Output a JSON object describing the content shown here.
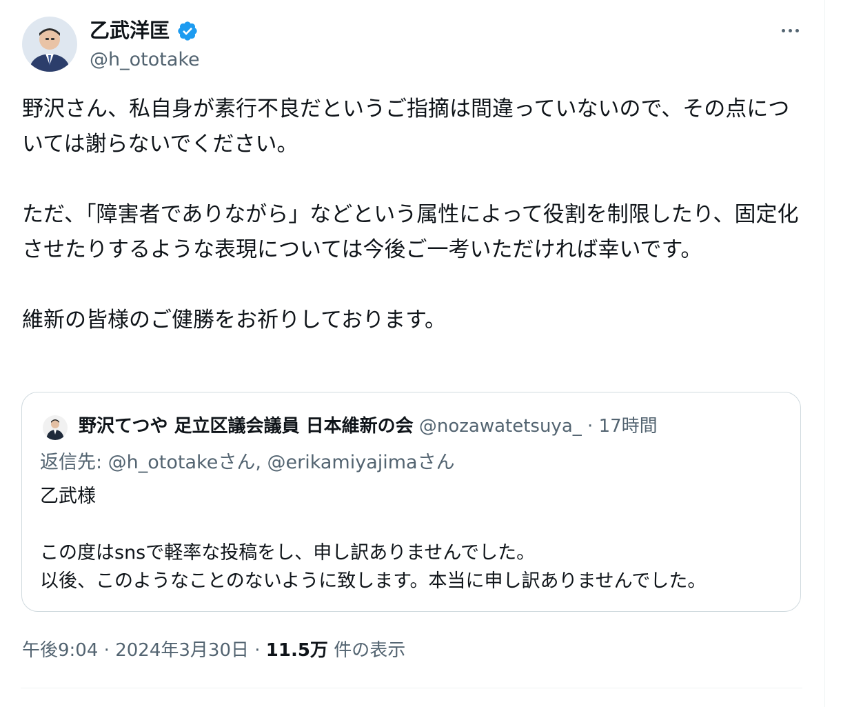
{
  "author": {
    "display_name": "乙武洋匡",
    "handle": "@h_ototake",
    "avatar": "person-portrait",
    "verified_icon": "verified-badge-icon",
    "verified_color": "#1d9bf0"
  },
  "tweet": {
    "paragraphs": [
      "野沢さん、私自身が素行不良だというご指摘は間違っていないので、その点については謝らないでください。",
      "ただ、「障害者でありながら」などという属性によって役割を制限したり、固定化させたりするような表現については今後ご一考いただければ幸いです。",
      "維新の皆様のご健勝をお祈りしております。"
    ]
  },
  "quote": {
    "author_name": "野沢てつや 足立区議会議員 日本維新の会",
    "handle": "@nozawatetsuya_",
    "separator": "·",
    "time": "17時間",
    "reply_to": "返信先: @h_ototakeさん, @erikamiyajimaさん",
    "text_lines": [
      "乙武様",
      "",
      "この度はsnsで軽率な投稿をし、申し訳ありませんでした。",
      "以後、このようなことのないように致します。本当に申し訳ありませんでした。"
    ]
  },
  "meta": {
    "time": "午後9:04",
    "separator": "·",
    "date": "2024年3月30日",
    "views_count": "11.5万",
    "views_label": "件の表示"
  },
  "more_icon": "more-horizontal-icon",
  "colors": {
    "text_primary": "#0f1419",
    "text_secondary": "#536471",
    "border": "#cfd9de",
    "verified": "#1d9bf0"
  }
}
